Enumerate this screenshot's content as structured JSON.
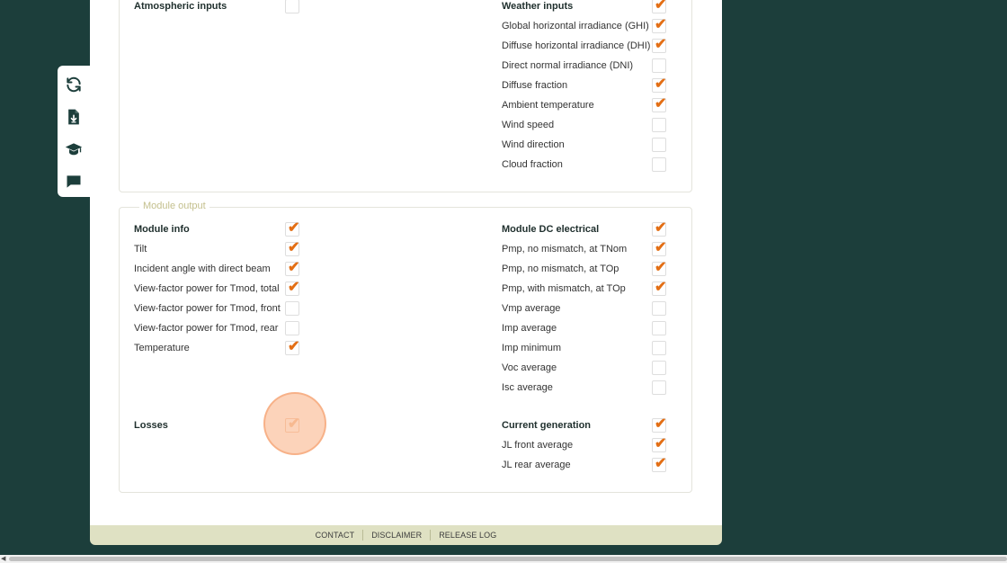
{
  "toolbar": {
    "icons": [
      "refresh-icon",
      "download-file-icon",
      "graduation-cap-icon",
      "chat-icon"
    ],
    "color": "#1c3e3b"
  },
  "sections": {
    "module_output_legend": "Module output"
  },
  "left_top": [
    {
      "label": "Atmospheric inputs",
      "header": true,
      "checked": false
    }
  ],
  "right_top": [
    {
      "label": "Weather inputs",
      "header": true,
      "checked": true
    },
    {
      "label": "Global horizontal irradiance (GHI)",
      "header": false,
      "checked": true
    },
    {
      "label": "Diffuse horizontal irradiance (DHI)",
      "header": false,
      "checked": true
    },
    {
      "label": "Direct normal irradiance (DNI)",
      "header": false,
      "checked": false
    },
    {
      "label": "Diffuse fraction",
      "header": false,
      "checked": true
    },
    {
      "label": "Ambient temperature",
      "header": false,
      "checked": true
    },
    {
      "label": "Wind speed",
      "header": false,
      "checked": false
    },
    {
      "label": "Wind direction",
      "header": false,
      "checked": false
    },
    {
      "label": "Cloud fraction",
      "header": false,
      "checked": false
    }
  ],
  "left_module": [
    {
      "label": "Module info",
      "header": true,
      "checked": true
    },
    {
      "label": "Tilt",
      "header": false,
      "checked": true
    },
    {
      "label": "Incident angle with direct beam",
      "header": false,
      "checked": true
    },
    {
      "label": "View-factor power for Tmod, total",
      "header": false,
      "checked": true
    },
    {
      "label": "View-factor power for Tmod, front",
      "header": false,
      "checked": false
    },
    {
      "label": "View-factor power for Tmod, rear",
      "header": false,
      "checked": false
    },
    {
      "label": "Temperature",
      "header": false,
      "checked": true
    }
  ],
  "left_losses": [
    {
      "label": "Losses",
      "header": true,
      "checked": true
    }
  ],
  "right_module": [
    {
      "label": "Module DC electrical",
      "header": true,
      "checked": true
    },
    {
      "label": "Pmp, no mismatch, at TNom",
      "header": false,
      "checked": true
    },
    {
      "label": "Pmp, no mismatch, at TOp",
      "header": false,
      "checked": true
    },
    {
      "label": "Pmp, with mismatch, at TOp",
      "header": false,
      "checked": true
    },
    {
      "label": "Vmp average",
      "header": false,
      "checked": false
    },
    {
      "label": "Imp average",
      "header": false,
      "checked": false
    },
    {
      "label": "Imp minimum",
      "header": false,
      "checked": false
    },
    {
      "label": "Voc average",
      "header": false,
      "checked": false
    },
    {
      "label": "Isc average",
      "header": false,
      "checked": false
    }
  ],
  "right_current": [
    {
      "label": "Current generation",
      "header": true,
      "checked": true
    },
    {
      "label": "JL front average",
      "header": false,
      "checked": true
    },
    {
      "label": "JL rear average",
      "header": false,
      "checked": true
    }
  ],
  "footer": {
    "contact": "CONTACT",
    "disclaimer": "DISCLAIMER",
    "release_log": "RELEASE LOG"
  },
  "colors": {
    "background": "#1c3e3b",
    "check": "#e36e14",
    "footer": "#dfe1c3"
  }
}
